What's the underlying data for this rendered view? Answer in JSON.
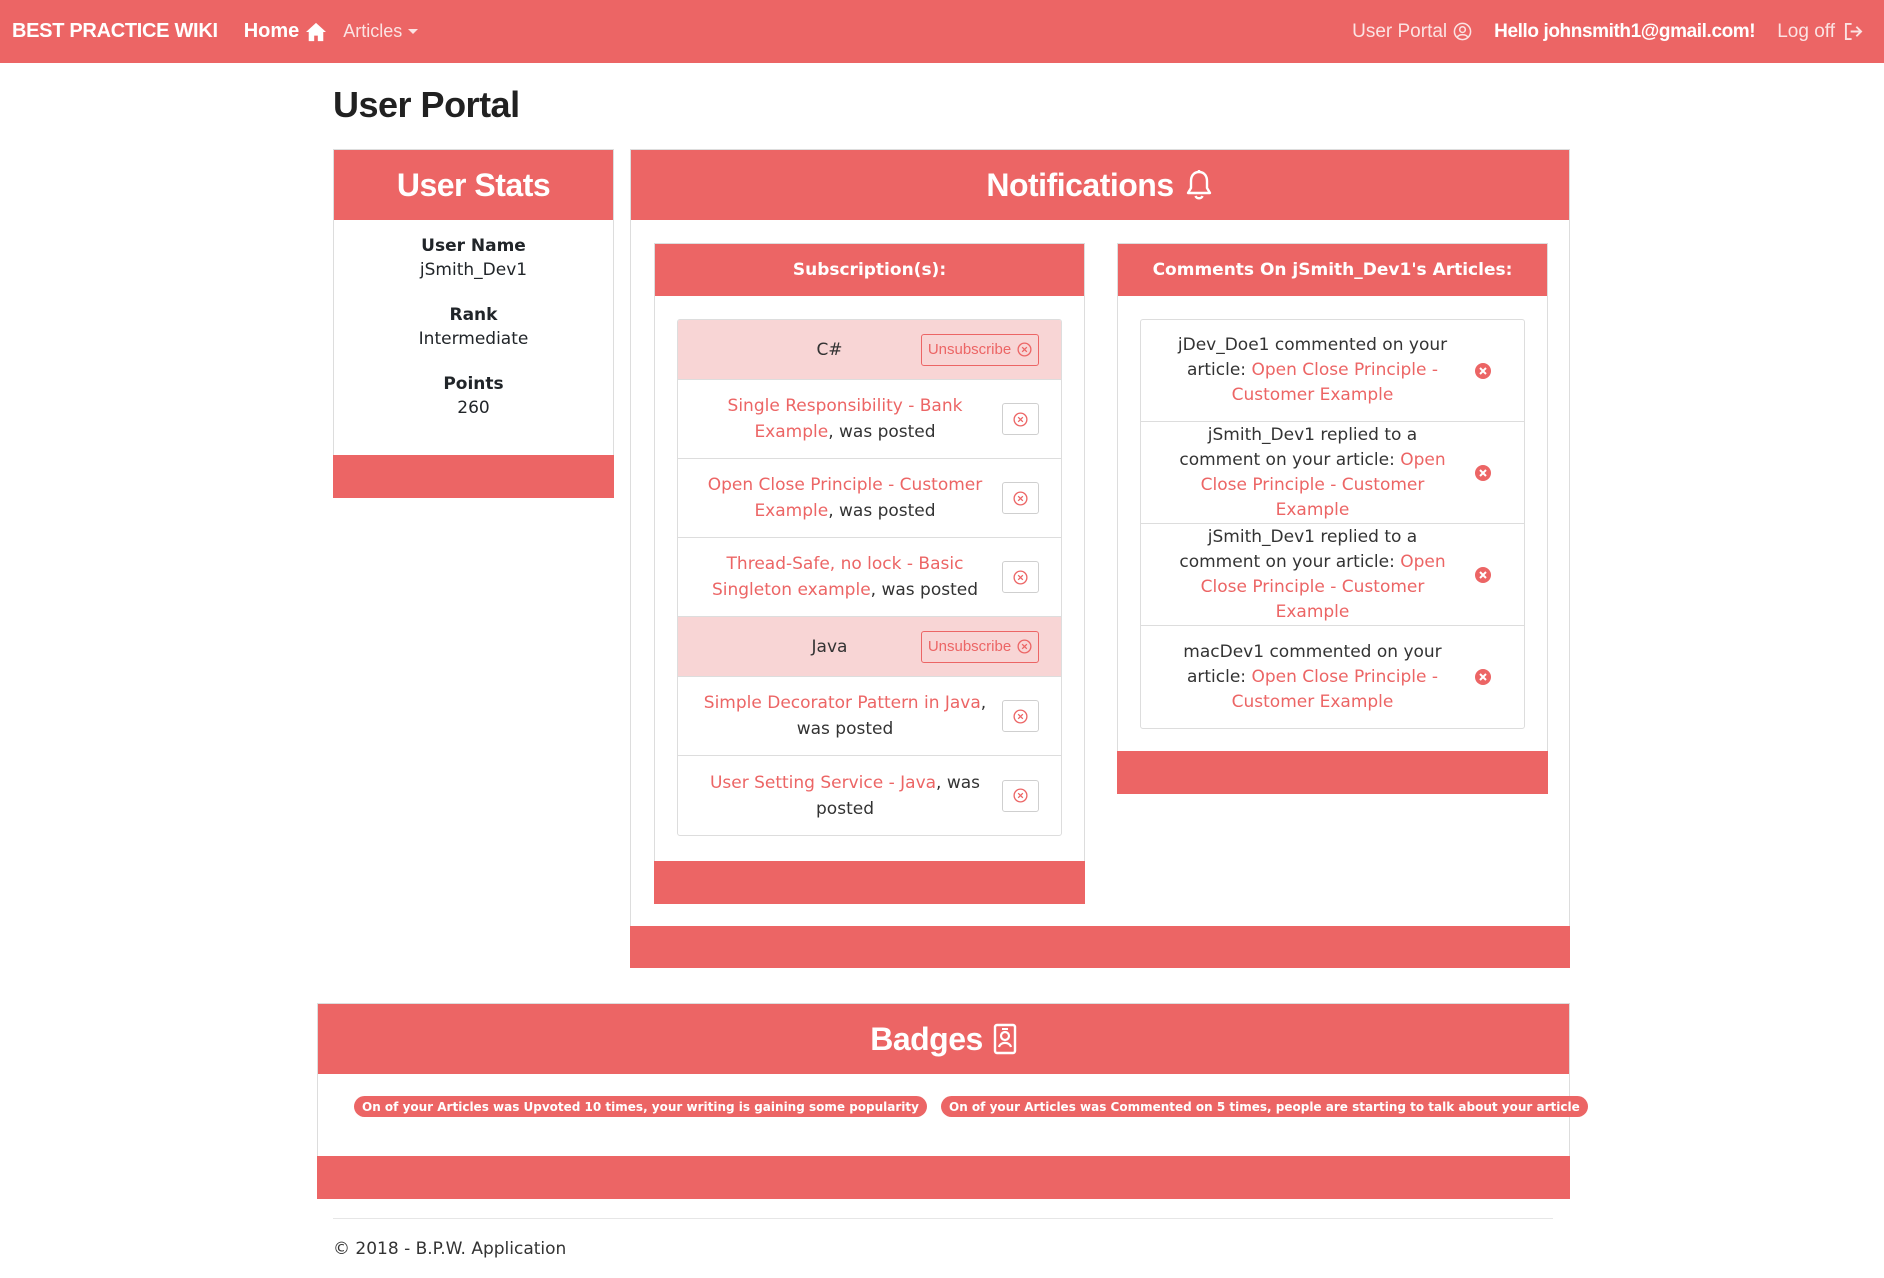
{
  "navbar": {
    "brand": "BEST PRACTICE WIKI",
    "home": "Home",
    "articles": "Articles",
    "user_portal": "User Portal",
    "hello": "Hello johnsmith1@gmail.com!",
    "log_off": "Log off",
    "icons": [
      "home-icon",
      "chevron-down-icon",
      "user-circle-icon",
      "sign-out-icon"
    ]
  },
  "page": {
    "title": "User Portal"
  },
  "user_stats": {
    "title": "User Stats",
    "username_label": "User Name",
    "username": "jSmith_Dev1",
    "rank_label": "Rank",
    "rank": "Intermediate",
    "points_label": "Points",
    "points": "260"
  },
  "notifications": {
    "title": "Notifications",
    "subscriptions": {
      "title": "Subscription(s):",
      "unsubscribe_label": "Unsubscribe",
      "groups": [
        {
          "topic": "C#",
          "items": [
            {
              "link": "Single Responsibility - Bank Example",
              "suffix": ", was posted"
            },
            {
              "link": "Open Close Principle - Customer Example",
              "suffix": ", was posted"
            },
            {
              "link": "Thread-Safe, no lock - Basic Singleton example",
              "suffix": ", was posted"
            }
          ]
        },
        {
          "topic": "Java",
          "items": [
            {
              "link": "Simple Decorator Pattern in Java",
              "suffix": ", was posted"
            },
            {
              "link": "User Setting Service - Java",
              "suffix": ", was posted"
            }
          ]
        }
      ]
    },
    "comments": {
      "title": "Comments On jSmith_Dev1's Articles:",
      "items": [
        {
          "text": "jDev_Doe1 commented on your article: ",
          "link": "Open Close Principle - Customer Example"
        },
        {
          "text": "jSmith_Dev1 replied to a comment on your article: ",
          "link": "Open Close Principle - Customer Example"
        },
        {
          "text": "jSmith_Dev1 replied to a comment on your article: ",
          "link": "Open Close Principle - Customer Example"
        },
        {
          "text": "macDev1 commented on your article: ",
          "link": "Open Close Principle - Customer Example"
        }
      ]
    }
  },
  "badges": {
    "title": "Badges",
    "items": [
      "On of your Articles was Upvoted 10 times, your writing is gaining some popularity",
      "On of your Articles was Commented on 5 times, people are starting to talk about your article"
    ]
  },
  "footer": {
    "text": "© 2018 - B.P.W. Application"
  },
  "colors": {
    "brand": "#ec6565",
    "topic_row": "#f8d5d5"
  }
}
